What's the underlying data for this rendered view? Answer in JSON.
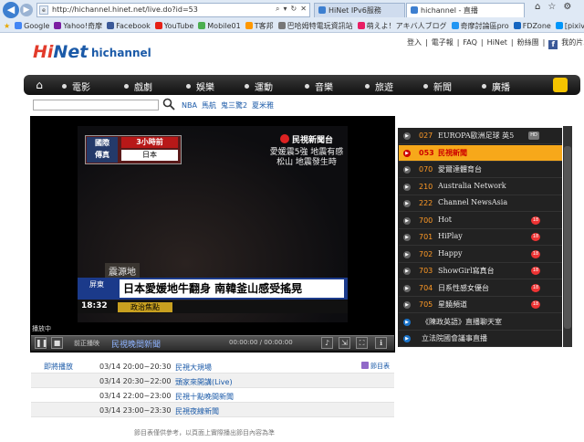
{
  "browser": {
    "address": "http://hichannel.hinet.net/live.do?id=53",
    "tabs": [
      "HiNet IPv6服務",
      "hichannel - 直播"
    ],
    "favorites": [
      "Google",
      "Yahoo!奇摩",
      "Facebook",
      "YouTube",
      "Mobile01",
      "T客邦",
      "巴哈姆特電玩資訊站",
      "萌えよ！アキバ人ブログ",
      "奇摩討論區pro",
      "FDZone",
      "[pixiv]",
      "伊莉討論區"
    ]
  },
  "header": {
    "logo_hi": "Hi",
    "logo_net": "Net",
    "logo_ch": "hichannel",
    "toplinks": [
      "登入",
      "電子報",
      "FAQ",
      "HiNet",
      "粉絲團",
      "我的片單"
    ]
  },
  "nav": [
    "電影",
    "戲劇",
    "娛樂",
    "運動",
    "音樂",
    "旅遊",
    "新聞",
    "廣播"
  ],
  "search": {
    "hot": [
      "NBA",
      "馬航",
      "鬼三驚2",
      "夏米雅"
    ]
  },
  "video": {
    "box_left": "國際\n傳真",
    "box_r1": "3小時前",
    "box_r2": "日本",
    "logo": "民視新聞台",
    "news": "愛媛震5強 地震有感 松山 地震發生時",
    "epicenter": "震源地",
    "city": "屏東",
    "headline": "日本愛媛地牛翻身 南韓釜山感受搖晃",
    "time": "18:32",
    "program": "政治焦點",
    "status": "播放中"
  },
  "controls": {
    "prev": "前正播映",
    "title": "民視晚間新聞",
    "time": "00:00:00 / 00:00:00"
  },
  "channels": [
    {
      "num": "027",
      "name": "EUROPA歐洲足球 英5",
      "badge": "HD"
    },
    {
      "num": "053",
      "name": "民視新聞",
      "badge": "",
      "active": true
    },
    {
      "num": "070",
      "name": "愛爾達體育台",
      "badge": ""
    },
    {
      "num": "210",
      "name": "Australia Network",
      "badge": ""
    },
    {
      "num": "222",
      "name": "Channel NewsAsia",
      "badge": ""
    },
    {
      "num": "700",
      "name": "Hot",
      "badge": "18"
    },
    {
      "num": "701",
      "name": "HiPlay",
      "badge": "18"
    },
    {
      "num": "702",
      "name": "Happy",
      "badge": "18"
    },
    {
      "num": "703",
      "name": "ShowGirl寫真台",
      "badge": "18"
    },
    {
      "num": "704",
      "name": "日系性感女優台",
      "badge": "18"
    },
    {
      "num": "705",
      "name": "星饒頻道",
      "badge": "18"
    }
  ],
  "subchannels": [
    "《陳政英語》直播聊天室",
    "立法院國會議事直播"
  ],
  "schedule": {
    "label": "即將播放",
    "all": "節目表",
    "rows": [
      {
        "time": "03/14 20:00~20:30",
        "program": "民視大規場"
      },
      {
        "time": "03/14 20:30~22:00",
        "program": "頭家來開講(Live)"
      },
      {
        "time": "03/14 22:00~23:00",
        "program": "民視十點晚間新聞"
      },
      {
        "time": "03/14 23:00~23:30",
        "program": "民視夜線新聞"
      }
    ],
    "note": "節目表僅供參考，以頁面上實際播出節目內容為準"
  }
}
